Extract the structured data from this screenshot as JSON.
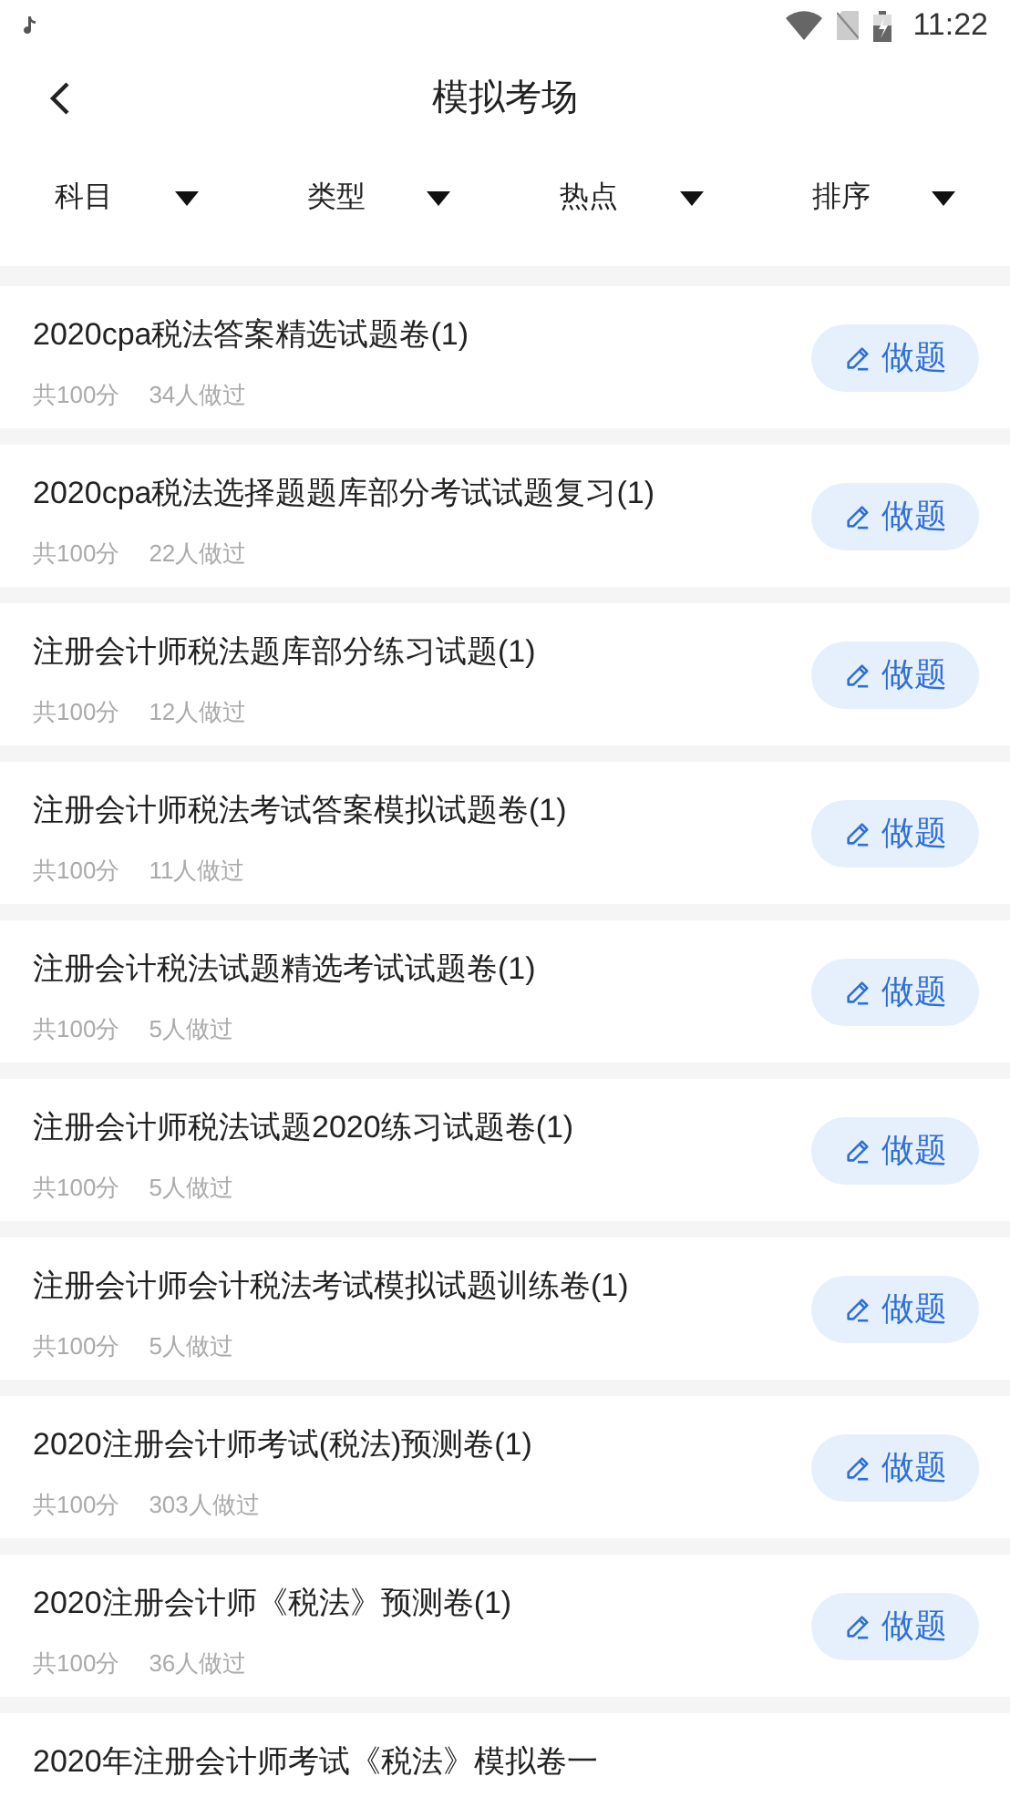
{
  "status_bar": {
    "time": "11:22"
  },
  "header": {
    "title": "模拟考场"
  },
  "filters": [
    {
      "label": "科目"
    },
    {
      "label": "类型"
    },
    {
      "label": "热点"
    },
    {
      "label": "排序"
    }
  ],
  "papers": [
    {
      "title": "2020cpa税法答案精选试题卷(1)",
      "score": "共100分",
      "taken": "34人做过",
      "action": "做题"
    },
    {
      "title": "2020cpa税法选择题题库部分考试试题复习(1)",
      "score": "共100分",
      "taken": "22人做过",
      "action": "做题"
    },
    {
      "title": "注册会计师税法题库部分练习试题(1)",
      "score": "共100分",
      "taken": "12人做过",
      "action": "做题"
    },
    {
      "title": "注册会计师税法考试答案模拟试题卷(1)",
      "score": "共100分",
      "taken": "11人做过",
      "action": "做题"
    },
    {
      "title": "注册会计税法试题精选考试试题卷(1)",
      "score": "共100分",
      "taken": "5人做过",
      "action": "做题"
    },
    {
      "title": "注册会计师税法试题2020练习试题卷(1)",
      "score": "共100分",
      "taken": "5人做过",
      "action": "做题"
    },
    {
      "title": "注册会计师会计税法考试模拟试题训练卷(1)",
      "score": "共100分",
      "taken": "5人做过",
      "action": "做题"
    },
    {
      "title": "2020注册会计师考试(税法)预测卷(1)",
      "score": "共100分",
      "taken": "303人做过",
      "action": "做题"
    },
    {
      "title": "2020注册会计师《税法》预测卷(1)",
      "score": "共100分",
      "taken": "36人做过",
      "action": "做题"
    },
    {
      "title": "2020年注册会计师考试《税法》模拟卷一"
    }
  ]
}
